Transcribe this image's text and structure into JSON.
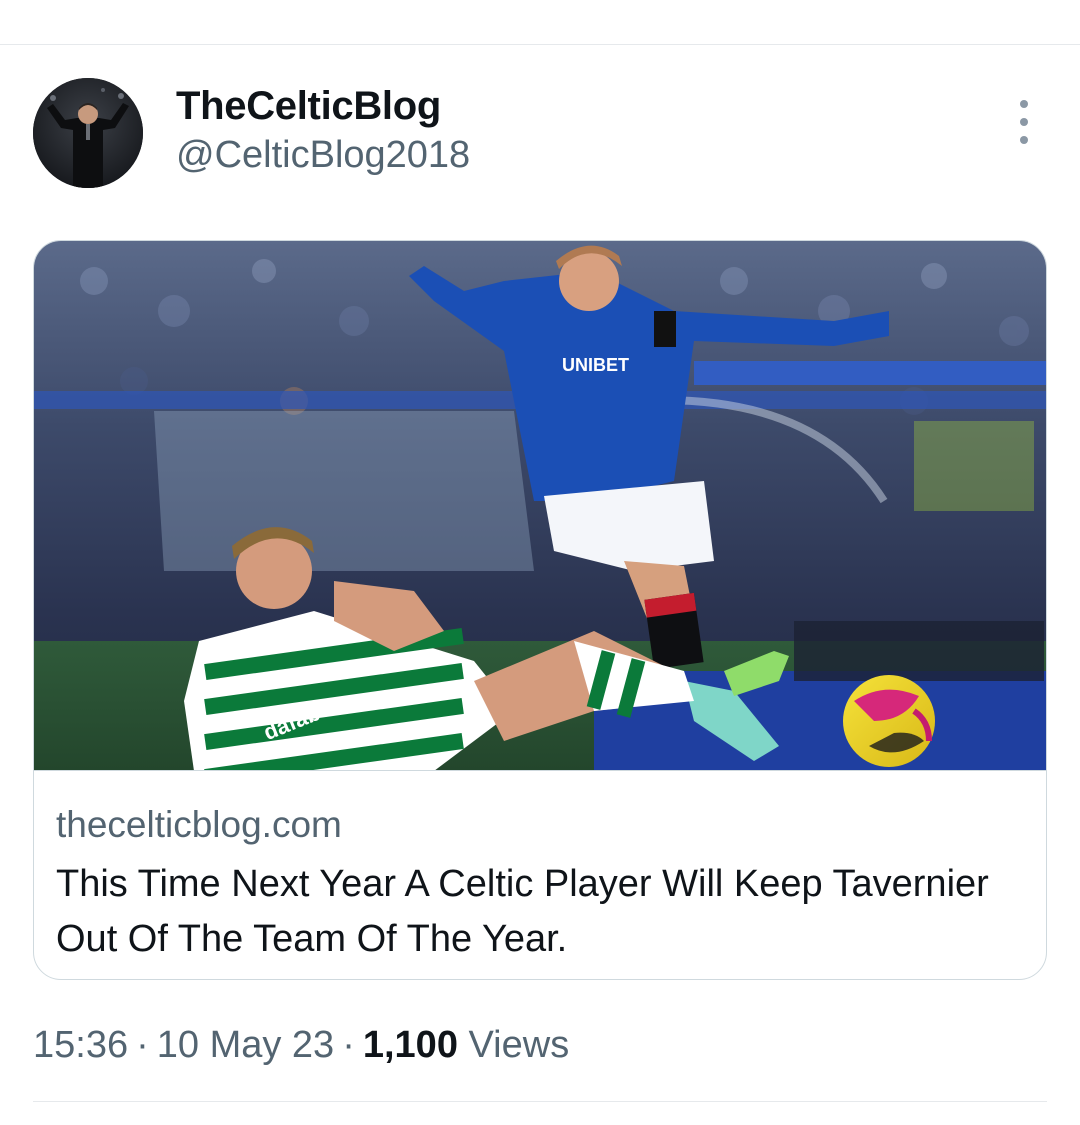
{
  "tweet": {
    "author": {
      "display_name": "TheCelticBlog",
      "handle": "@CelticBlog2018"
    },
    "more_icon": "more-vertical-icon",
    "link_card": {
      "domain": "thecelticblog.com",
      "title": "This Time Next Year A Celtic Player Will Keep Tavernier Out Of The Team Of The Year."
    },
    "meta": {
      "time": "15:36",
      "date": "10 May 23",
      "views_count": "1,100",
      "views_label": "Views",
      "separator": "·"
    }
  },
  "colors": {
    "primary_text": "#0f1419",
    "secondary_text": "#536471",
    "border": "#cfd9de",
    "rangers_blue": "#1b4fb5",
    "celtic_green": "#0b7a3a"
  }
}
